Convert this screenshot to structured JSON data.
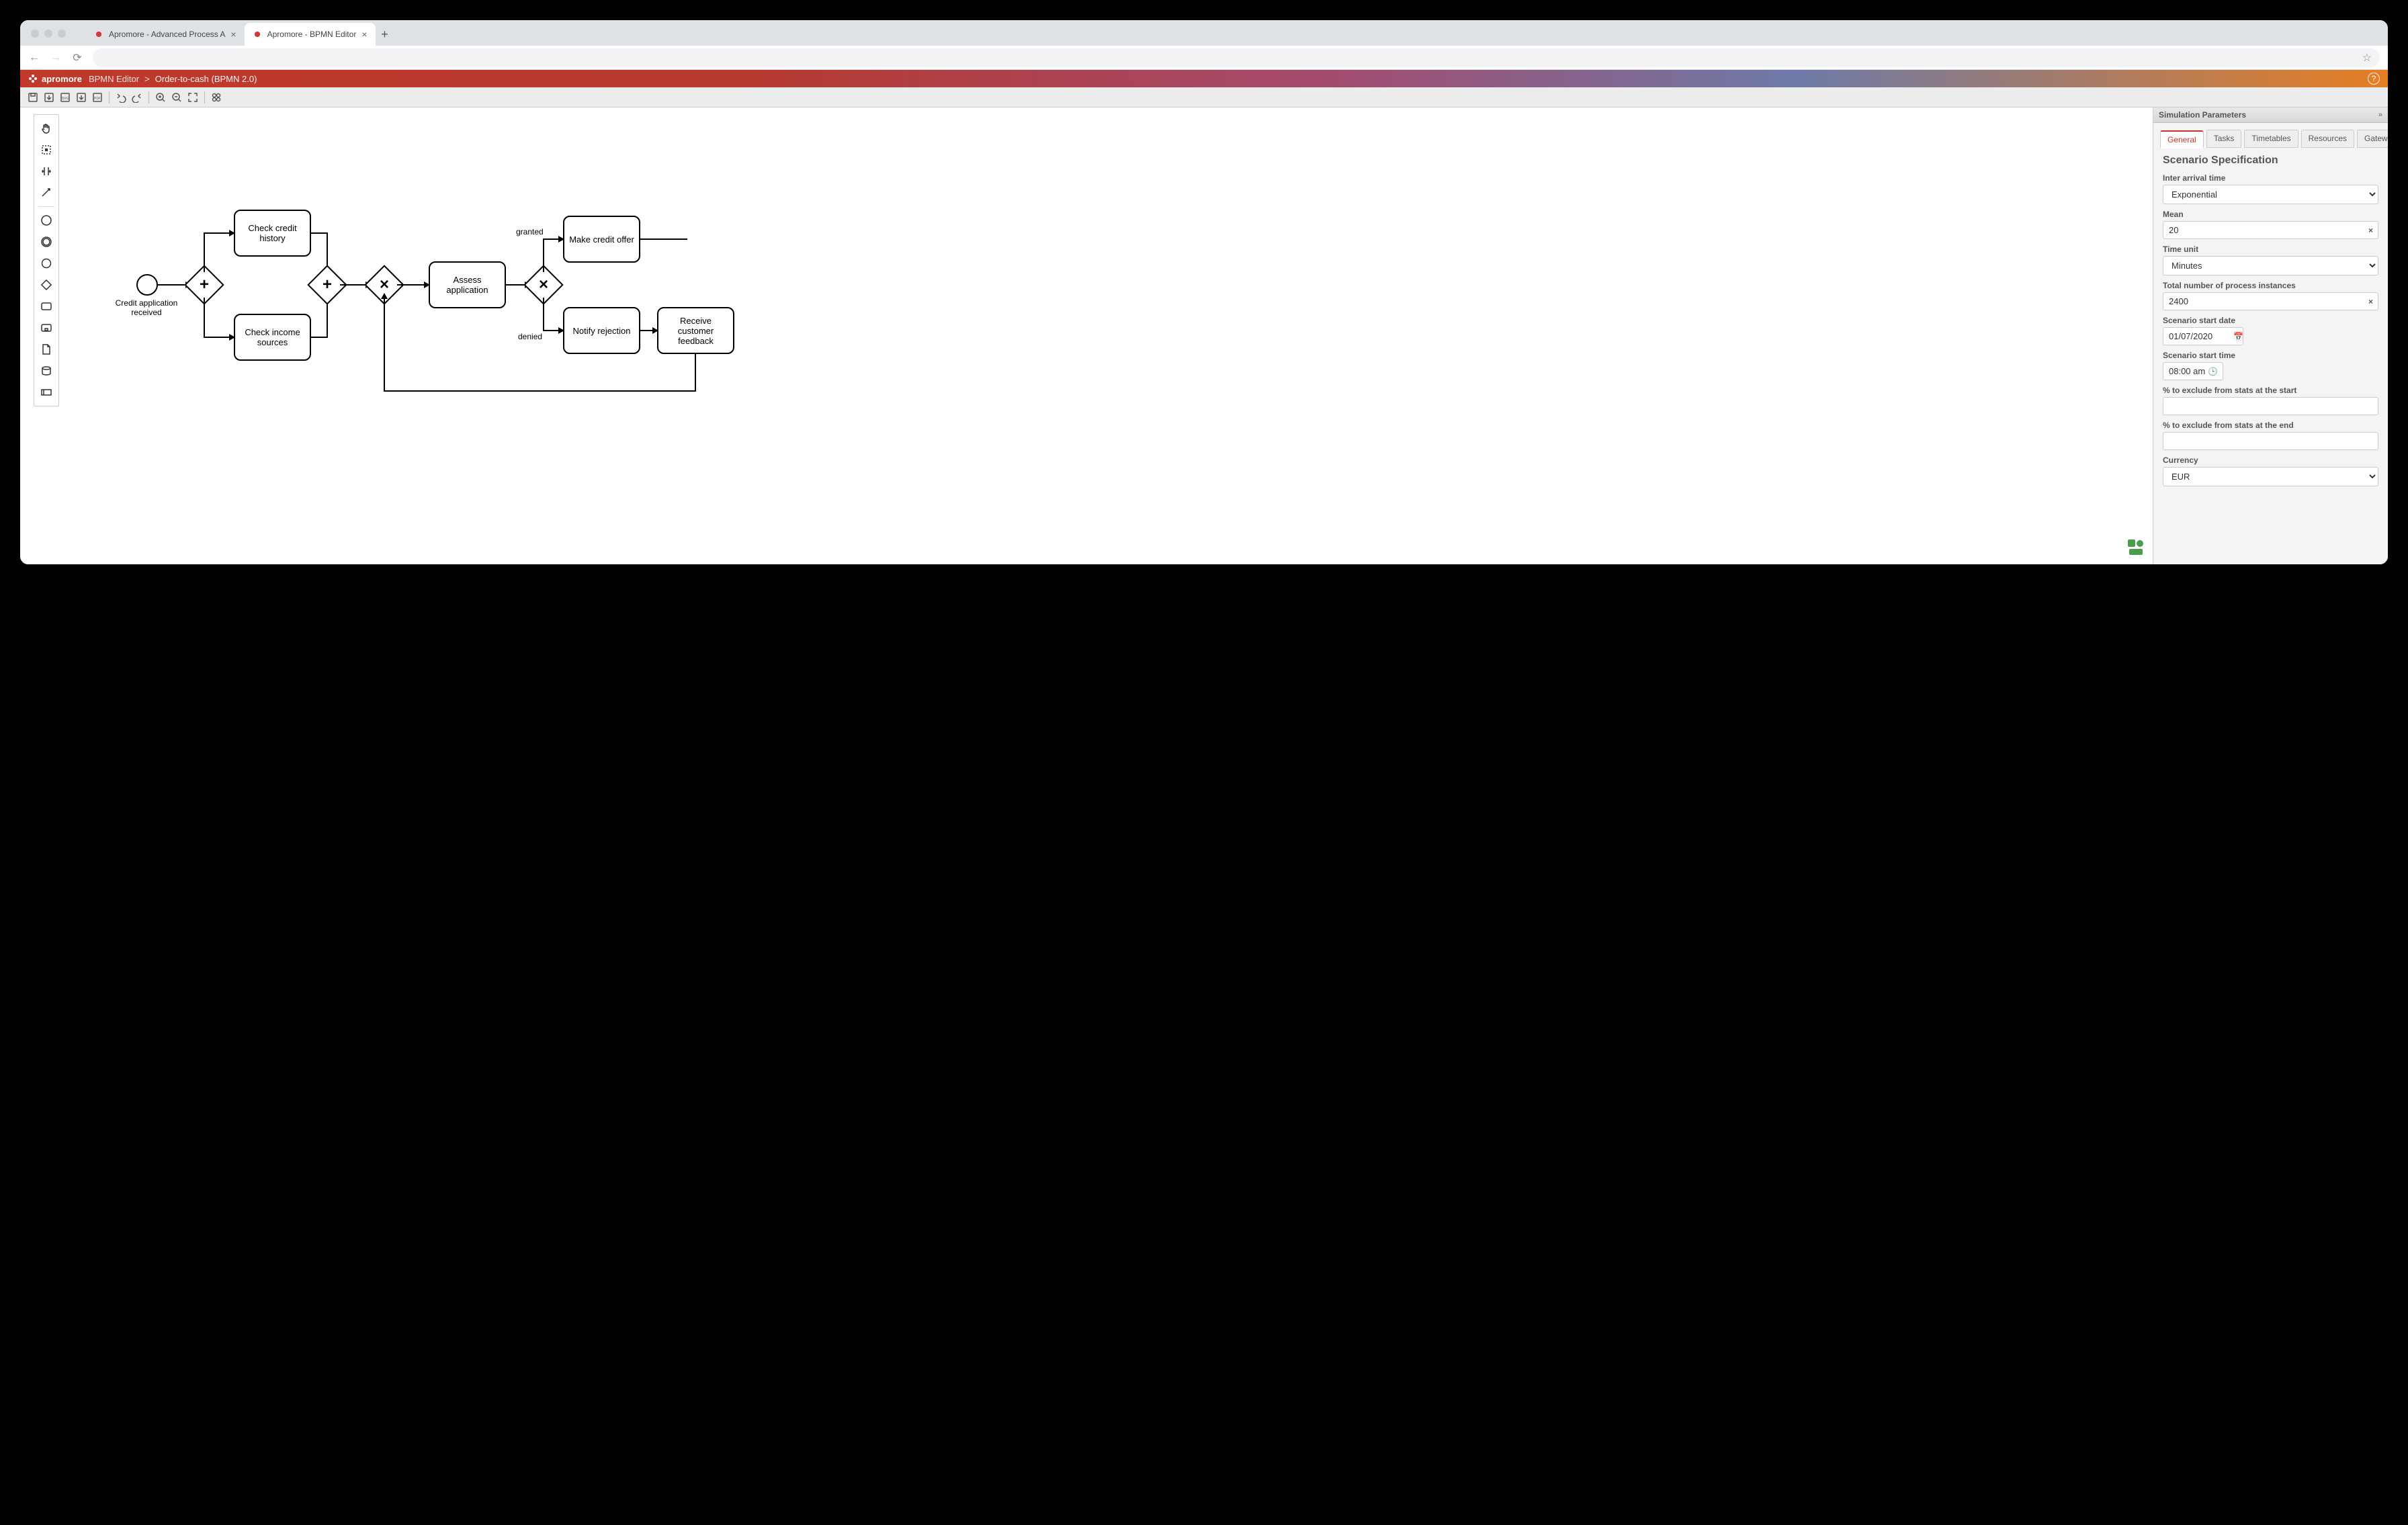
{
  "browser": {
    "tabs": [
      {
        "title": "Apromore - Advanced Process A",
        "active": false
      },
      {
        "title": "Apromore - BPMN Editor",
        "active": true
      }
    ]
  },
  "appbar": {
    "brand": "apromore",
    "section": "BPMN Editor",
    "sep": ">",
    "crumb": "Order-to-cash (BPMN 2.0)"
  },
  "diagram": {
    "start_label": "Credit application received",
    "tasks": {
      "check_credit": "Check credit history",
      "check_income": "Check income sources",
      "assess": "Assess application",
      "offer": "Make credit offer",
      "notify": "Notify rejection",
      "feedback": "Receive customer feedback"
    },
    "edges": {
      "granted": "granted",
      "denied": "denied"
    }
  },
  "panel": {
    "title": "Simulation Parameters",
    "tabs": [
      "General",
      "Tasks",
      "Timetables",
      "Resources",
      "Gateways"
    ],
    "active_tab": "General",
    "heading": "Scenario Specification",
    "fields": {
      "inter_arrival": {
        "label": "Inter arrival time",
        "value": "Exponential"
      },
      "mean": {
        "label": "Mean",
        "value": "20"
      },
      "time_unit": {
        "label": "Time unit",
        "value": "Minutes"
      },
      "instances": {
        "label": "Total number of process instances",
        "value": "2400"
      },
      "start_date": {
        "label": "Scenario start date",
        "value": "01/07/2020"
      },
      "start_time": {
        "label": "Scenario start time",
        "value": "08:00 am"
      },
      "exclude_start": {
        "label": "% to exclude from stats at the start",
        "value": ""
      },
      "exclude_end": {
        "label": "% to exclude from stats at the end",
        "value": ""
      },
      "currency": {
        "label": "Currency",
        "value": "EUR"
      }
    }
  }
}
